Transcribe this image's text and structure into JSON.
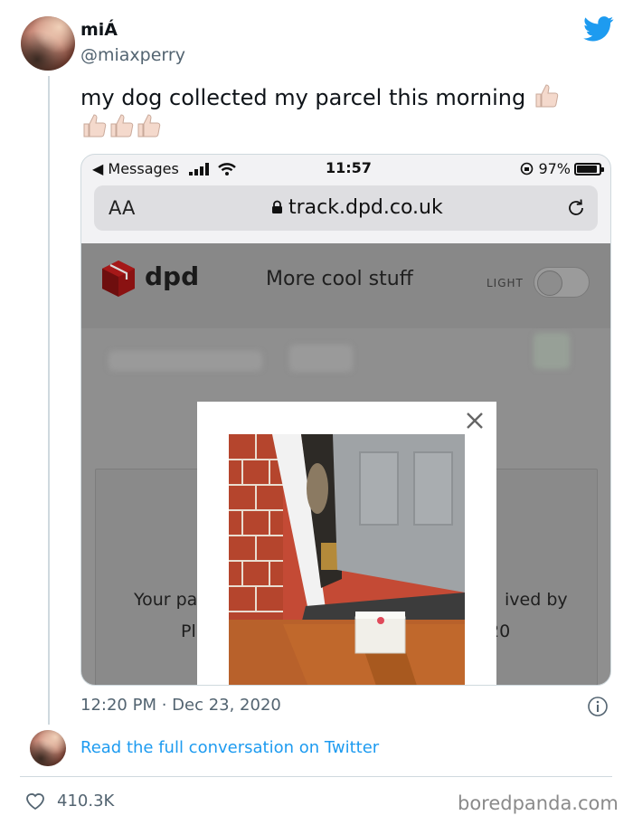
{
  "tweet": {
    "display_name": "miÁ",
    "handle": "@miaxperry",
    "text": "my dog collected my parcel this morning",
    "emoji_name": "thumbs-up",
    "timestamp": "12:20 PM · Dec 23, 2020",
    "read_link": "Read the full conversation on Twitter",
    "likes": "410.3K",
    "link_color": "#1d9bf0"
  },
  "phone": {
    "back_label": "◀ Messages",
    "time": "11:57",
    "battery": "97%",
    "text_size_label": "AA",
    "url": "track.dpd.co.uk"
  },
  "dpd": {
    "brand": "dpd",
    "menu_text": "More cool stuff",
    "theme_label": "LIGHT",
    "brand_color": "#b31a1a",
    "card_line1_left": "Your pa",
    "card_line1_right": "ived by",
    "card_line2_left": "Pl",
    "card_line2_right": "20"
  },
  "watermark": "boredpanda.com"
}
